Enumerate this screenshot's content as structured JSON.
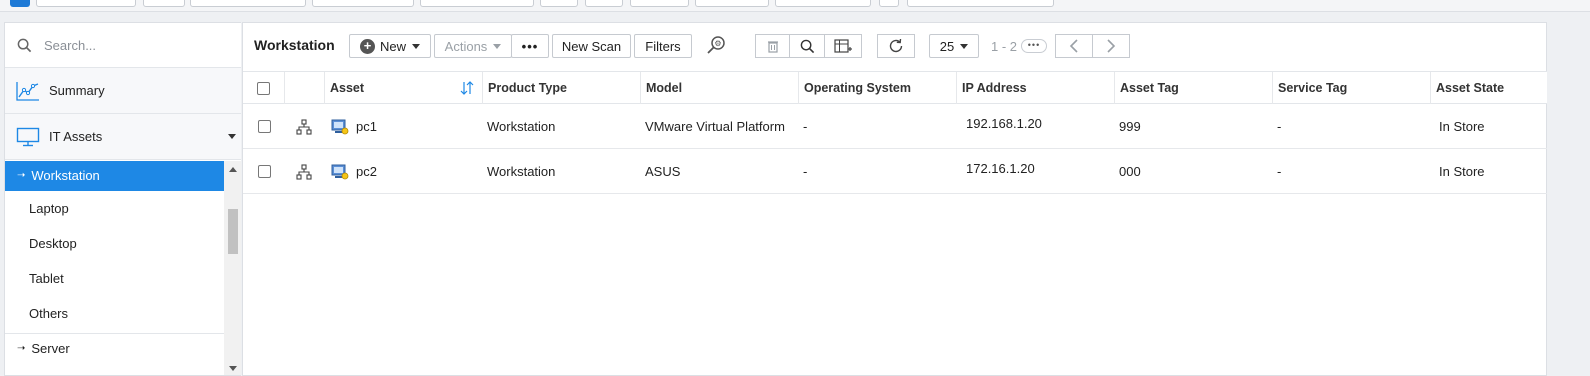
{
  "colors": {
    "accent": "#1e88e5",
    "disabled": "#9aa0a6",
    "border": "#c6cad0"
  },
  "sidebar": {
    "search_placeholder": "Search...",
    "summary_label": "Summary",
    "summary_icon": "line-chart-icon",
    "it_assets_label": "IT Assets",
    "it_assets_icon": "monitor-icon",
    "items": [
      {
        "label": "Workstation",
        "active": true
      },
      {
        "label": "Laptop"
      },
      {
        "label": "Desktop"
      },
      {
        "label": "Tablet"
      },
      {
        "label": "Others"
      }
    ],
    "server_label": "Server"
  },
  "toolbar": {
    "title": "Workstation",
    "new_label": "New",
    "actions_label": "Actions",
    "new_scan_label": "New Scan",
    "filters_label": "Filters",
    "page_size": "25",
    "page_range": "1 - 2"
  },
  "table": {
    "columns": [
      "Asset",
      "Product Type",
      "Model",
      "Operating System",
      "IP Address",
      "Asset Tag",
      "Service Tag",
      "Asset State"
    ],
    "rows": [
      {
        "asset": "pc1",
        "product_type": "Workstation",
        "model": "VMware Virtual Platform",
        "os": "-",
        "ip": "192.168.1.20",
        "asset_tag": "999",
        "service_tag": "-",
        "state": "In Store"
      },
      {
        "asset": "pc2",
        "product_type": "Workstation",
        "model": "ASUS",
        "os": "-",
        "ip": "172.16.1.20",
        "asset_tag": "000",
        "service_tag": "-",
        "state": "In Store"
      }
    ]
  }
}
